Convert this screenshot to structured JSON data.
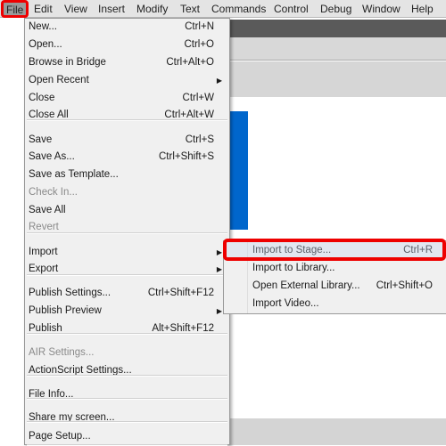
{
  "menubar": [
    "File",
    "Edit",
    "View",
    "Insert",
    "Modify",
    "Text",
    "Commands",
    "Control",
    "Debug",
    "Window",
    "Help"
  ],
  "file_menu": [
    {
      "label": "New...",
      "shortcut": "Ctrl+N"
    },
    {
      "label": "Open...",
      "shortcut": "Ctrl+O"
    },
    {
      "label": "Browse in Bridge",
      "shortcut": "Ctrl+Alt+O"
    },
    {
      "label": "Open Recent",
      "submenu": true
    },
    {
      "label": "Close",
      "shortcut": "Ctrl+W"
    },
    {
      "label": "Close All",
      "shortcut": "Ctrl+Alt+W"
    },
    {
      "label": "Save",
      "shortcut": "Ctrl+S"
    },
    {
      "label": "Save As...",
      "shortcut": "Ctrl+Shift+S"
    },
    {
      "label": "Save as Template..."
    },
    {
      "label": "Check In...",
      "disabled": true
    },
    {
      "label": "Save All"
    },
    {
      "label": "Revert",
      "disabled": true
    },
    {
      "label": "Import",
      "submenu": true
    },
    {
      "label": "Export",
      "submenu": true
    },
    {
      "label": "Publish Settings...",
      "shortcut": "Ctrl+Shift+F12"
    },
    {
      "label": "Publish Preview",
      "submenu": true
    },
    {
      "label": "Publish",
      "shortcut": "Alt+Shift+F12"
    },
    {
      "label": "AIR Settings...",
      "disabled": true
    },
    {
      "label": "ActionScript Settings..."
    },
    {
      "label": "File Info..."
    },
    {
      "label": "Share my screen..."
    },
    {
      "label": "Page Setup..."
    }
  ],
  "import_submenu": [
    {
      "label": "Import to Stage...",
      "shortcut": "Ctrl+R"
    },
    {
      "label": "Import to Library..."
    },
    {
      "label": "Open External Library...",
      "shortcut": "Ctrl+Shift+O"
    },
    {
      "label": "Import Video..."
    }
  ],
  "colors": {
    "highlight": "#ee0000",
    "stage_blue": "#0066cc"
  }
}
